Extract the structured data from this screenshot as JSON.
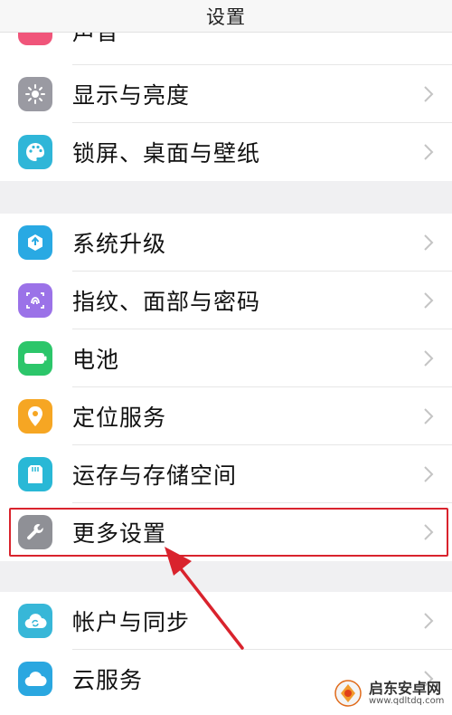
{
  "header": {
    "title": "设置"
  },
  "groups": [
    {
      "items": [
        {
          "label": "声音",
          "icon": "sound-icon",
          "color": "#f0557a"
        },
        {
          "label": "显示与亮度",
          "icon": "brightness-icon",
          "color": "#9a9aa2"
        },
        {
          "label": "锁屏、桌面与壁纸",
          "icon": "palette-icon",
          "color": "#2fb6d8"
        }
      ]
    },
    {
      "items": [
        {
          "label": "系统升级",
          "icon": "system-update-icon",
          "color": "#29a9e3"
        },
        {
          "label": "指纹、面部与密码",
          "icon": "fingerprint-icon",
          "color": "#9b72e8"
        },
        {
          "label": "电池",
          "icon": "battery-icon",
          "color": "#2cc66a"
        },
        {
          "label": "定位服务",
          "icon": "location-icon",
          "color": "#f6a623"
        },
        {
          "label": "运存与存储空间",
          "icon": "storage-icon",
          "color": "#29b8d6"
        },
        {
          "label": "更多设置",
          "icon": "wrench-icon",
          "color": "#8f9096"
        }
      ]
    },
    {
      "items": [
        {
          "label": "帐户与同步",
          "icon": "account-sync-icon",
          "color": "#37b7d8"
        },
        {
          "label": "云服务",
          "icon": "cloud-icon",
          "color": "#2aa7e0"
        }
      ]
    }
  ],
  "annotation": {
    "highlight_color": "#d9232d",
    "arrow_color": "#d9232d"
  },
  "watermark": {
    "name": "启东安卓网",
    "url": "www.qdltdq.com"
  }
}
